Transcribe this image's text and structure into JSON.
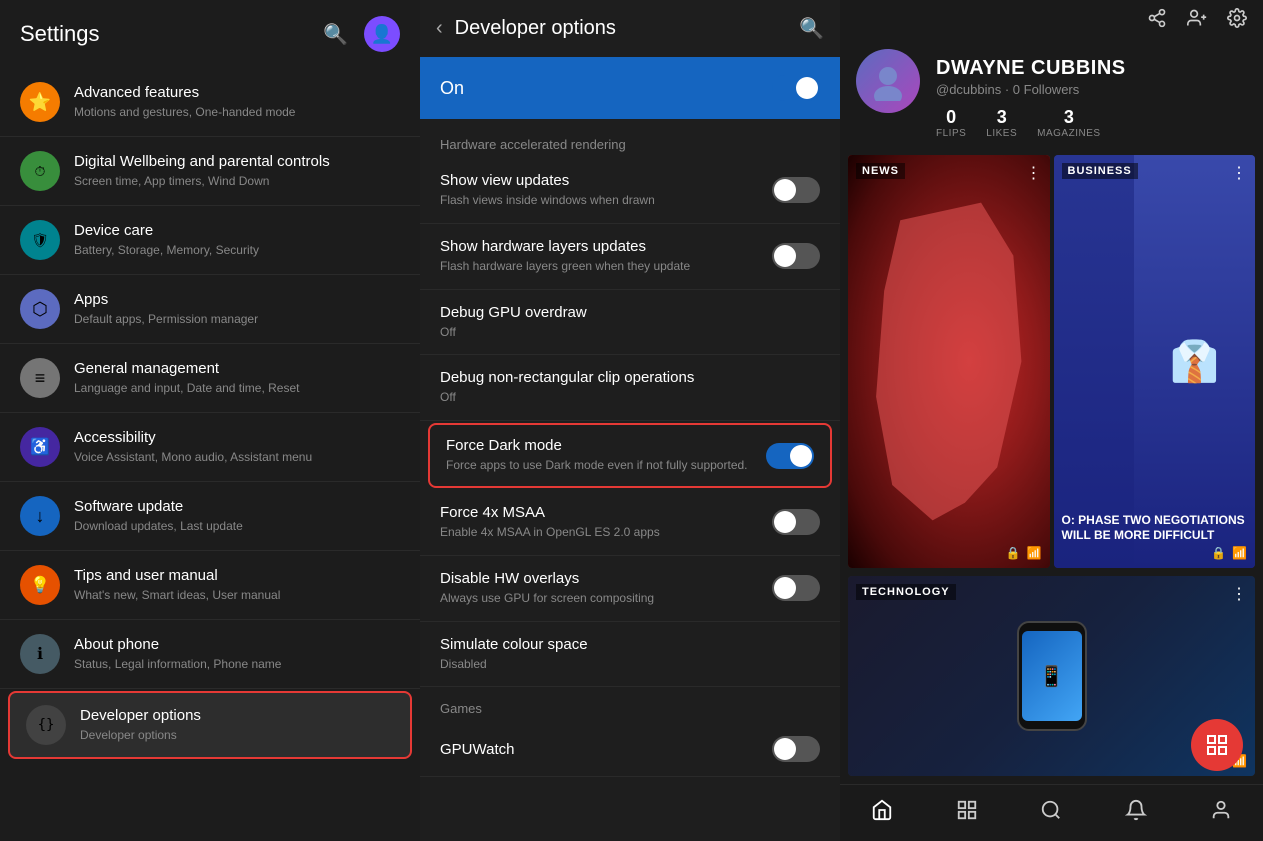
{
  "settings": {
    "title": "Settings",
    "search_icon": "🔍",
    "avatar_icon": "👤",
    "items": [
      {
        "id": "advanced-features",
        "label": "Advanced features",
        "sublabel": "Motions and gestures, One-handed mode",
        "icon": "⭐",
        "icon_bg": "#f57c00",
        "active": false
      },
      {
        "id": "digital-wellbeing",
        "label": "Digital Wellbeing and parental controls",
        "sublabel": "Screen time, App timers, Wind Down",
        "icon": "⏱",
        "icon_bg": "#388e3c",
        "active": false
      },
      {
        "id": "device-care",
        "label": "Device care",
        "sublabel": "Battery, Storage, Memory, Security",
        "icon": "🛡",
        "icon_bg": "#00838f",
        "active": false
      },
      {
        "id": "apps",
        "label": "Apps",
        "sublabel": "Default apps, Permission manager",
        "icon": "⬡",
        "icon_bg": "#5c6bc0",
        "active": false
      },
      {
        "id": "general-management",
        "label": "General management",
        "sublabel": "Language and input, Date and time, Reset",
        "icon": "≡",
        "icon_bg": "#757575",
        "active": false
      },
      {
        "id": "accessibility",
        "label": "Accessibility",
        "sublabel": "Voice Assistant, Mono audio, Assistant menu",
        "icon": "♿",
        "icon_bg": "#4527a0",
        "active": false
      },
      {
        "id": "software-update",
        "label": "Software update",
        "sublabel": "Download updates, Last update",
        "icon": "↓",
        "icon_bg": "#1565c0",
        "active": false
      },
      {
        "id": "tips",
        "label": "Tips and user manual",
        "sublabel": "What's new, Smart ideas, User manual",
        "icon": "💡",
        "icon_bg": "#e65100",
        "active": false
      },
      {
        "id": "about-phone",
        "label": "About phone",
        "sublabel": "Status, Legal information, Phone name",
        "icon": "ℹ",
        "icon_bg": "#455a64",
        "active": false
      },
      {
        "id": "developer-options",
        "label": "Developer options",
        "sublabel": "Developer options",
        "icon": "{}",
        "icon_bg": "#424242",
        "active": true
      }
    ]
  },
  "developer_options": {
    "title": "Developer options",
    "back_icon": "‹",
    "search_icon": "🔍",
    "on_label": "On",
    "on_toggle": true,
    "section_hardware": "Hardware accelerated rendering",
    "items": [
      {
        "id": "show-view-updates",
        "label": "Show view updates",
        "sublabel": "Flash views inside windows when drawn",
        "toggle": false,
        "has_toggle": true
      },
      {
        "id": "show-hardware-layers",
        "label": "Show hardware layers updates",
        "sublabel": "Flash hardware layers green when they update",
        "toggle": false,
        "has_toggle": true
      },
      {
        "id": "debug-gpu-overdraw",
        "label": "Debug GPU overdraw",
        "sublabel": "Off",
        "toggle": false,
        "has_toggle": false
      },
      {
        "id": "debug-non-rectangular",
        "label": "Debug non-rectangular clip operations",
        "sublabel": "Off",
        "toggle": false,
        "has_toggle": false
      },
      {
        "id": "force-dark-mode",
        "label": "Force Dark mode",
        "sublabel": "Force apps to use Dark mode even if not fully supported.",
        "toggle": true,
        "has_toggle": true,
        "highlighted": true
      },
      {
        "id": "force-4x-msaa",
        "label": "Force 4x MSAA",
        "sublabel": "Enable 4x MSAA in OpenGL ES 2.0 apps",
        "toggle": false,
        "has_toggle": true
      },
      {
        "id": "disable-hw-overlays",
        "label": "Disable HW overlays",
        "sublabel": "Always use GPU for screen compositing",
        "toggle": false,
        "has_toggle": true
      },
      {
        "id": "simulate-colour-space",
        "label": "Simulate colour space",
        "sublabel": "Disabled",
        "toggle": false,
        "has_toggle": false
      }
    ],
    "section_games": "Games",
    "games_items": [
      {
        "id": "gpuwatch",
        "label": "GPUWatch",
        "sublabel": "",
        "toggle": false,
        "has_toggle": true
      }
    ]
  },
  "flipboard": {
    "topbar_icons": [
      "share",
      "add-person",
      "settings"
    ],
    "profile": {
      "name": "DWAYNE CUBBINS",
      "handle": "@dcubbins · 0 Followers",
      "flips": "0",
      "flips_label": "FLIPS",
      "likes": "3",
      "likes_label": "LIKES",
      "magazines": "3",
      "magazines_label": "MAGAZINES"
    },
    "cards": [
      {
        "id": "news",
        "label": "NEWS",
        "type": "news"
      },
      {
        "id": "business",
        "label": "BUSINESS",
        "type": "business",
        "text": "O: PHASE TWO NEGOTIATIONS WILL BE MORE DIFFICULT"
      }
    ],
    "bottom_card": {
      "id": "technology",
      "label": "TECHNOLOGY",
      "type": "tech"
    },
    "fab_icon": "⊞",
    "nav_icons": [
      "home",
      "grid",
      "search",
      "bell",
      "person"
    ]
  }
}
